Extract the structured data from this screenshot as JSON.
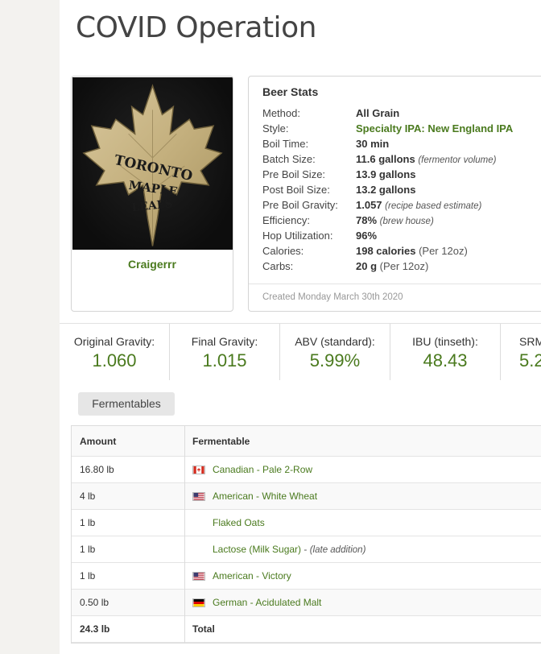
{
  "page": {
    "title": "COVID Operation"
  },
  "user": {
    "name": "Craigerrr",
    "avatar_text": [
      "TORONTO",
      "MAPLE",
      "LEAFS"
    ]
  },
  "beer_stats": {
    "title": "Beer Stats",
    "rows": [
      {
        "label": "Method:",
        "value": "All Grain",
        "note": ""
      },
      {
        "label": "Style:",
        "value": "Specialty IPA: New England IPA",
        "note": ""
      },
      {
        "label": "Boil Time:",
        "value": "30 min",
        "note": ""
      },
      {
        "label": "Batch Size:",
        "value": "11.6 gallons",
        "note": "(fermentor volume)"
      },
      {
        "label": "Pre Boil Size:",
        "value": "13.9 gallons",
        "note": ""
      },
      {
        "label": "Post Boil Size:",
        "value": "13.2 gallons",
        "note": ""
      },
      {
        "label": "Pre Boil Gravity:",
        "value": "1.057",
        "note": "(recipe based estimate)"
      },
      {
        "label": "Efficiency:",
        "value": "78%",
        "note": "(brew house)"
      },
      {
        "label": "Hop Utilization:",
        "value": "96%",
        "note": ""
      },
      {
        "label": "Calories:",
        "value": "198 calories",
        "note": "(Per 12oz)"
      },
      {
        "label": "Carbs:",
        "value": "20 g",
        "note": "(Per 12oz)"
      }
    ],
    "created": "Created Monday March 30th 2020"
  },
  "gravity": [
    {
      "label": "Original Gravity:",
      "value": "1.060"
    },
    {
      "label": "Final Gravity:",
      "value": "1.015"
    },
    {
      "label": "ABV (standard):",
      "value": "5.99%"
    },
    {
      "label": "IBU (tinseth):",
      "value": "48.43"
    },
    {
      "label": "SRM",
      "value": "5.2"
    }
  ],
  "fermentables": {
    "tab_label": "Fermentables",
    "headers": {
      "amount": "Amount",
      "fermentable": "Fermentable"
    },
    "rows": [
      {
        "amount": "16.80 lb",
        "name": "Canadian - Pale 2-Row",
        "flag": "ca",
        "note": ""
      },
      {
        "amount": "4 lb",
        "name": "American - White Wheat",
        "flag": "us",
        "note": ""
      },
      {
        "amount": "1 lb",
        "name": "Flaked Oats",
        "flag": "",
        "note": ""
      },
      {
        "amount": "1 lb",
        "name": "Lactose (Milk Sugar)",
        "flag": "",
        "note": "(late addition)"
      },
      {
        "amount": "1 lb",
        "name": "American - Victory",
        "flag": "us",
        "note": ""
      },
      {
        "amount": "0.50 lb",
        "name": "German - Acidulated Malt",
        "flag": "de",
        "note": ""
      }
    ],
    "total": {
      "amount": "24.3 lb",
      "label": "Total"
    }
  },
  "colors": {
    "accent_green": "#4a7a1e",
    "tab_bg": "#e6e6e6"
  }
}
